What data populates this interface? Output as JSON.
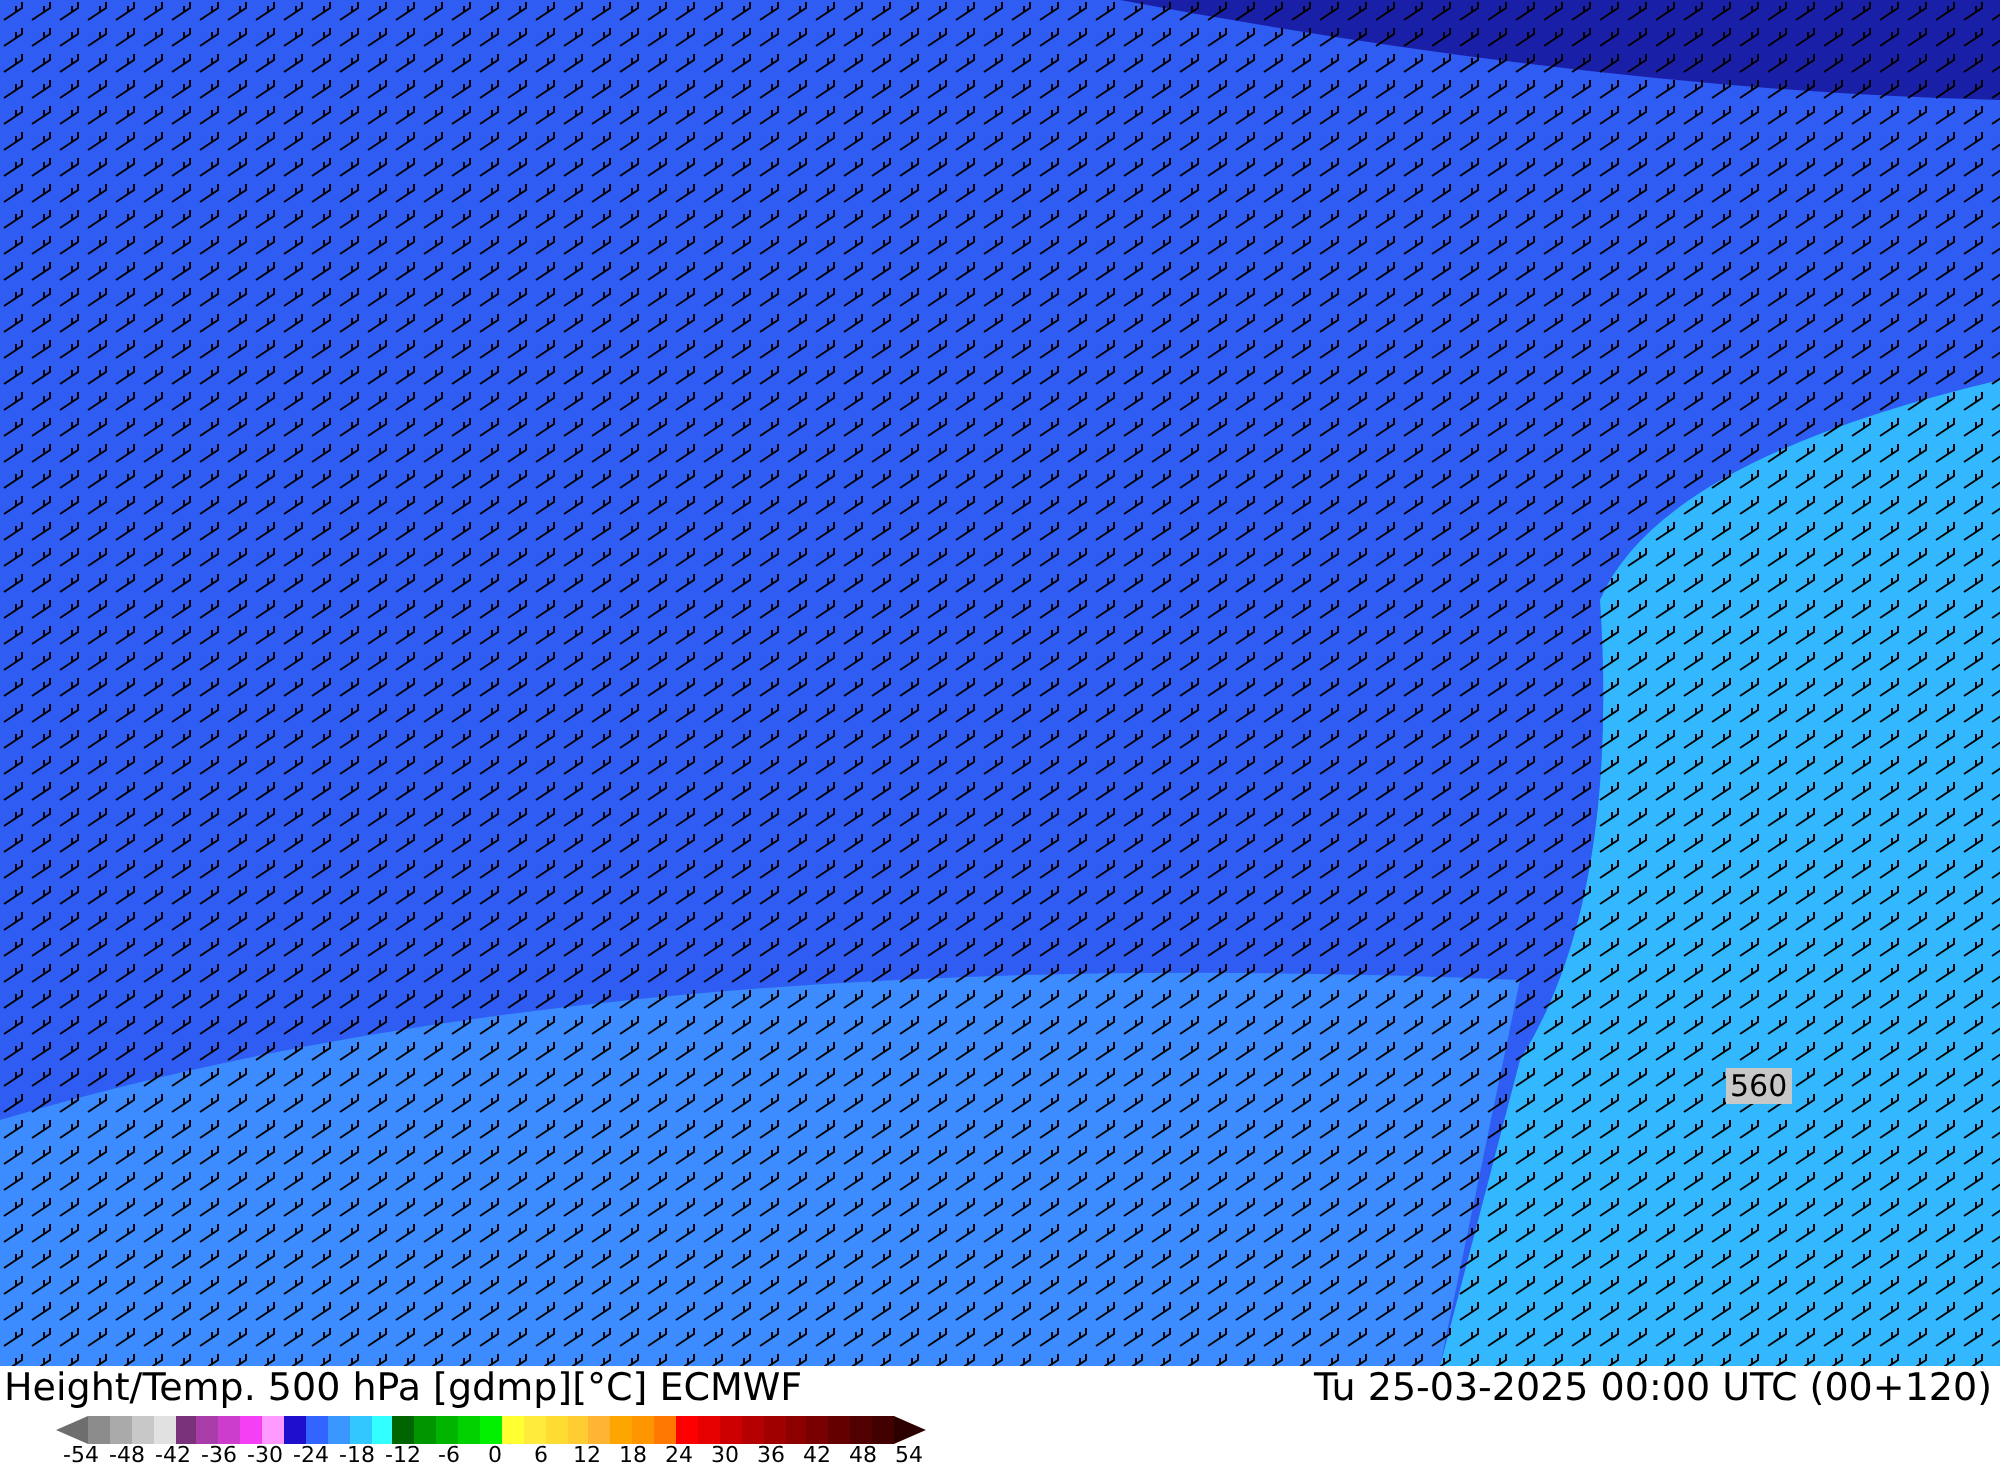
{
  "map": {
    "contour_label": "560"
  },
  "footer": {
    "title": "Height/Temp. 500 hPa [gdmp][°C] ECMWF",
    "valid_time": "Tu 25-03-2025 00:00 UTC (00+120)"
  },
  "legend": {
    "swatches": [
      {
        "kind": "arrow-left",
        "color": "#6e6e6e"
      },
      {
        "kind": "cell",
        "color": "#8c8c8c"
      },
      {
        "kind": "cell",
        "color": "#aaaaaa"
      },
      {
        "kind": "cell",
        "color": "#c8c8c8"
      },
      {
        "kind": "cell",
        "color": "#e1e1e1"
      },
      {
        "kind": "cell",
        "color": "#7a337a"
      },
      {
        "kind": "cell",
        "color": "#a83ca8"
      },
      {
        "kind": "cell",
        "color": "#cc3dcc"
      },
      {
        "kind": "cell",
        "color": "#f53ff5"
      },
      {
        "kind": "cell",
        "color": "#ff99ff"
      },
      {
        "kind": "cell",
        "color": "#1e0fcc"
      },
      {
        "kind": "cell",
        "color": "#3264ff"
      },
      {
        "kind": "cell",
        "color": "#3c96ff"
      },
      {
        "kind": "cell",
        "color": "#32c8ff"
      },
      {
        "kind": "cell",
        "color": "#32ffff"
      },
      {
        "kind": "cell",
        "color": "#006400"
      },
      {
        "kind": "cell",
        "color": "#009600"
      },
      {
        "kind": "cell",
        "color": "#00b400"
      },
      {
        "kind": "cell",
        "color": "#00d200"
      },
      {
        "kind": "cell",
        "color": "#00f000"
      },
      {
        "kind": "cell",
        "color": "#ffff32"
      },
      {
        "kind": "cell",
        "color": "#ffeb3c"
      },
      {
        "kind": "cell",
        "color": "#ffdc32"
      },
      {
        "kind": "cell",
        "color": "#ffcd32"
      },
      {
        "kind": "cell",
        "color": "#ffb432"
      },
      {
        "kind": "cell",
        "color": "#ffa500"
      },
      {
        "kind": "cell",
        "color": "#ff9600"
      },
      {
        "kind": "cell",
        "color": "#ff7800"
      },
      {
        "kind": "cell",
        "color": "#ff0000"
      },
      {
        "kind": "cell",
        "color": "#e60000"
      },
      {
        "kind": "cell",
        "color": "#cc0000"
      },
      {
        "kind": "cell",
        "color": "#b40000"
      },
      {
        "kind": "cell",
        "color": "#a00000"
      },
      {
        "kind": "cell",
        "color": "#8c0000"
      },
      {
        "kind": "cell",
        "color": "#780000"
      },
      {
        "kind": "cell",
        "color": "#640000"
      },
      {
        "kind": "cell",
        "color": "#500000"
      },
      {
        "kind": "cell",
        "color": "#420000"
      },
      {
        "kind": "arrow-right",
        "color": "#2d0000"
      }
    ],
    "ticks": [
      "-54",
      "-48",
      "-42",
      "-36",
      "-30",
      "-24",
      "-18",
      "-12",
      "-6",
      "0",
      "6",
      "12",
      "18",
      "24",
      "30",
      "36",
      "42",
      "48",
      "54"
    ]
  }
}
